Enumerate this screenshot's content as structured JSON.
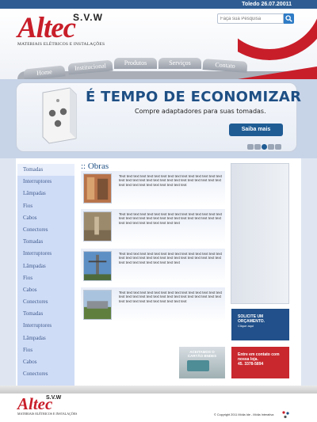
{
  "topbar": {
    "date": "Toledo 26.07.20011"
  },
  "logo": {
    "svw": "S.V.W",
    "brand": "Altec",
    "tagline": "MATERIAIS ELÉTRICOS E INSTALAÇÕES"
  },
  "search": {
    "placeholder": "Faça sua Pesquisa"
  },
  "menu": [
    "Home",
    "Institucional",
    "Produtos",
    "Serviços",
    "Contato"
  ],
  "banner": {
    "headline": "É TEMPO DE ECONOMIZAR",
    "subline": "Compre adaptadores para suas tomadas.",
    "button": "Saiba mais"
  },
  "sidebar": {
    "items": [
      "Tomadas",
      "Interruptores",
      "Lâmpadas",
      "Fios",
      "Cabos",
      "Conectores",
      "Tomadas",
      "Interruptores",
      "Lâmpadas",
      "Fios",
      "Cabos",
      "Conectores",
      "Tomadas",
      "Interruptores",
      "Lâmpadas",
      "Fios",
      "Cabos",
      "Conectores"
    ]
  },
  "section": {
    "title": ":: Obras"
  },
  "obras": [
    {
      "text": "Text text text text text text text text text text text text text text text text text text text text text text text text text text text text text text text text text text text text text text text text"
    },
    {
      "text": "Text text text text text text text text text text text text text text text text text text text text text text text text text text text text text text text text text text text text text text text"
    },
    {
      "text": "Text text text text text text text text text text text text text text text text text text text text text text text text text text text text text text text text text text text text text text text"
    },
    {
      "text": "Text text text text text text text text text text text text text text text text text text text text text text text text text text text text text text text text text text text text text text text text"
    }
  ],
  "promos": {
    "quote_title": "SOLICITE UM ORÇAMENTO.",
    "quote_sub": "Clique aqui",
    "contact_line1": "Entre em contato com",
    "contact_line2": "nossa loja.",
    "contact_phone": "45. 3378-5894",
    "cards_line1": "ACEITAMOS O",
    "cards_line2": "CARTÃO BNDES"
  },
  "footer": {
    "copyright": "© Copyright 2011 Mídia Ide - Mídia Interativa"
  },
  "colors": {
    "brand_red": "#c81e2a",
    "brand_blue": "#1e4f84",
    "nav_blue": "#2f5d93"
  }
}
